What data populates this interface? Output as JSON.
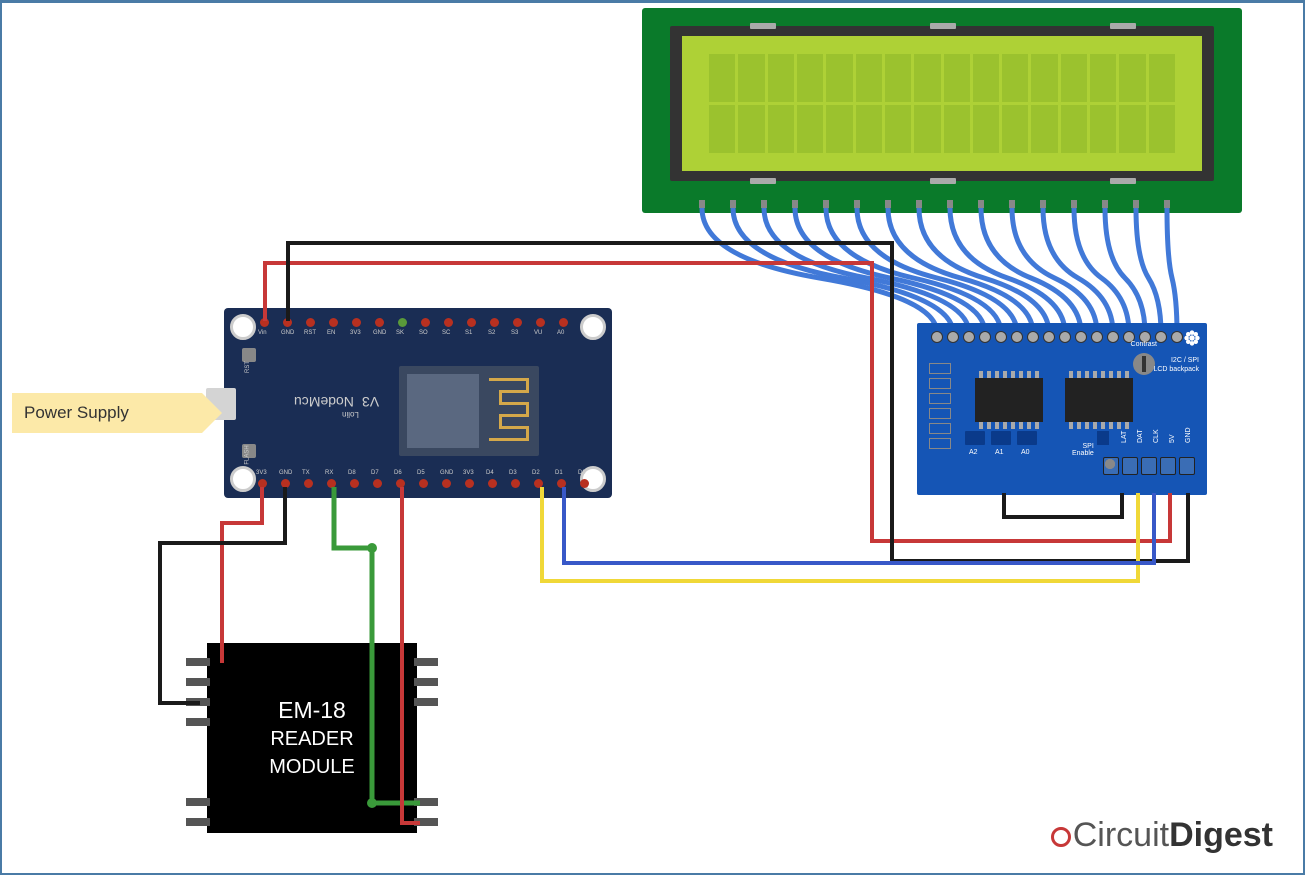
{
  "diagram": {
    "power_supply_label": "Power Supply",
    "em18": {
      "line1": "EM-18",
      "line2": "READER",
      "line3": "MODULE"
    },
    "nodemcu": {
      "title": "NodeMcu",
      "version": "V3",
      "subtitle": "Lolin",
      "btn_rst": "RST",
      "btn_flash": "FLASH",
      "top_pins": [
        "Vin",
        "GND",
        "RST",
        "EN",
        "3V3",
        "GND",
        "SK",
        "SO",
        "SC",
        "S1",
        "S2",
        "S3",
        "VU",
        "A0"
      ],
      "bottom_pins": [
        "3V3",
        "GND",
        "TX",
        "RX",
        "D8",
        "D7",
        "D6",
        "D5",
        "GND",
        "3V3",
        "D4",
        "D3",
        "D2",
        "D1",
        "D0"
      ]
    },
    "i2c_backpack": {
      "title1": "I2C / SPI",
      "title2": "LCD backpack",
      "contrast": "Contrast",
      "spi_enable": "SPI\nEnable",
      "addr_labels": [
        "A2",
        "A1",
        "A0"
      ],
      "terminal_labels": [
        "LAT",
        "DAT",
        "CLK",
        "5V",
        "GND"
      ]
    },
    "wires": {
      "colors": {
        "vin_red": "#c73838",
        "gnd_black": "#1a1a1a",
        "sda_yellow": "#f0d838",
        "scl_blue": "#3858c8",
        "tx_green": "#3a9a3a"
      }
    },
    "logo": {
      "brand": "Circuit",
      "bold": "Digest"
    }
  }
}
